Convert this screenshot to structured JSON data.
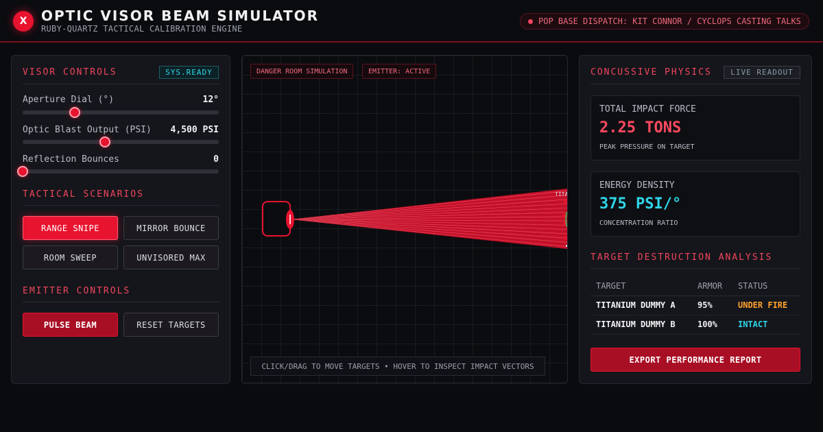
{
  "app": {
    "logo_letter": "X",
    "title": "OPTIC VISOR BEAM SIMULATOR",
    "subtitle": "RUBY-QUARTZ TACTICAL CALIBRATION ENGINE",
    "dispatch": "POP BASE DISPATCH: KIT CONNOR / CYCLOPS CASTING TALKS"
  },
  "left": {
    "visor_title": "VISOR CONTROLS",
    "status_badge": "SYS.READY",
    "sliders": [
      {
        "label": "Aperture Dial (°)",
        "value": "12°",
        "level": 0.265
      },
      {
        "label": "Optic Blast Output (PSI)",
        "value": "4,500 PSI",
        "level": 0.42
      },
      {
        "label": "Reflection Bounces",
        "value": "0",
        "level": 0.0
      }
    ],
    "scenarios_title": "TACTICAL SCENARIOS",
    "scenarios": [
      {
        "label": "RANGE SNIPE",
        "active": true
      },
      {
        "label": "MIRROR BOUNCE",
        "active": false
      },
      {
        "label": "ROOM SWEEP",
        "active": false
      },
      {
        "label": "UNVISORED MAX",
        "active": false
      }
    ],
    "emitter_title": "EMITTER CONTROLS",
    "pulse_label": "PULSE BEAM",
    "reset_label": "RESET TARGETS"
  },
  "center": {
    "chip_simulation": "DANGER ROOM SIMULATION",
    "chip_emitter": "EMITTER: ACTIVE",
    "target_label": "TITA",
    "hint": "CLICK/DRAG TO MOVE TARGETS • HOVER TO INSPECT IMPACT VECTORS",
    "beam_color": "#e8132f"
  },
  "right": {
    "physics_title": "CONCUSSIVE PHYSICS",
    "live_badge": "LIVE READOUT",
    "impact": {
      "label": "TOTAL IMPACT FORCE",
      "value": "2.25 TONS",
      "sub": "PEAK PRESSURE ON TARGET",
      "color": "#ff4a60"
    },
    "density": {
      "label": "ENERGY DENSITY",
      "value": "375 PSI/°",
      "sub": "CONCENTRATION RATIO",
      "color": "#2fd6e8"
    },
    "analysis_title": "TARGET DESTRUCTION ANALYSIS",
    "columns": [
      "TARGET",
      "ARMOR",
      "STATUS"
    ],
    "rows": [
      {
        "target": "TITANIUM DUMMY A",
        "armor": "95%",
        "status": "UNDER FIRE"
      },
      {
        "target": "TITANIUM DUMMY B",
        "armor": "100%",
        "status": "INTACT"
      }
    ],
    "export_label": "EXPORT PERFORMANCE REPORT"
  }
}
